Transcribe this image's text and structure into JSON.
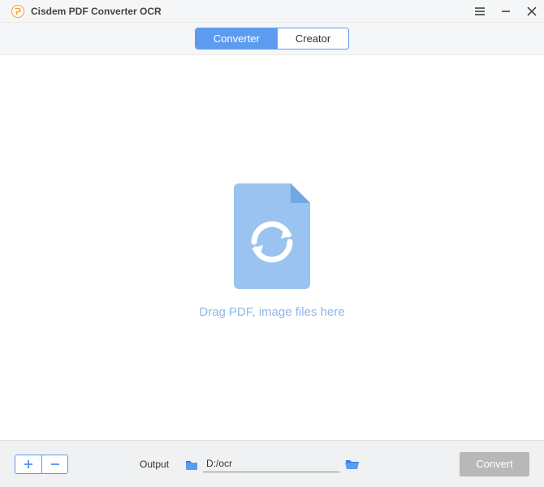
{
  "app": {
    "title": "Cisdem PDF Converter OCR"
  },
  "tabs": {
    "converter": "Converter",
    "creator": "Creator"
  },
  "main": {
    "drop_text": "Drag PDF, image files here"
  },
  "bottom": {
    "output_label": "Output",
    "output_path": "D:/ocr",
    "convert_label": "Convert"
  },
  "colors": {
    "accent": "#5D9BF0",
    "drop_icon": "#9AC3EF"
  }
}
